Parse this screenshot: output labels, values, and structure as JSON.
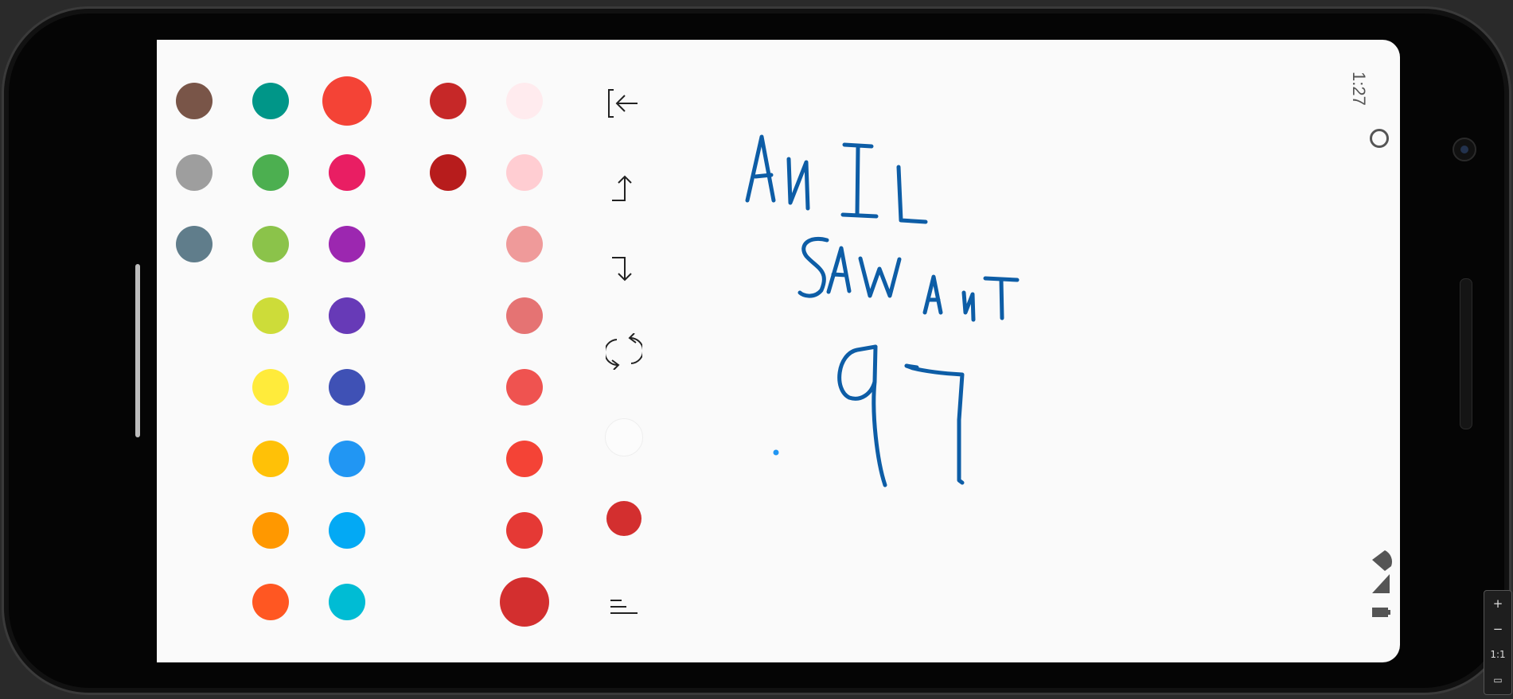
{
  "status_bar": {
    "time": "1:27"
  },
  "palette": {
    "col1": [
      "#795548",
      "#9e9e9e",
      "#607d8b"
    ],
    "col2": [
      "#009688",
      "#4caf50",
      "#8bc34a",
      "#cddc39",
      "#ffeb3b",
      "#ffc107",
      "#ff9800",
      "#ff5722"
    ],
    "col3": [
      "#f44336",
      "#e91e63",
      "#9c27b0",
      "#673ab7",
      "#3f51b5",
      "#2196f3",
      "#03a9f4",
      "#00bcd4"
    ],
    "col4": [
      "#c62828",
      "#b71c1c"
    ],
    "col5": [
      "#ffebee",
      "#ffcdd2",
      "#ef9a9a",
      "#e57373",
      "#ef5350",
      "#f44336",
      "#e53935",
      "#d32f2f"
    ]
  },
  "toolbar": {
    "exit_icon": "exit-icon",
    "undo_icon": "undo-icon",
    "redo_icon": "redo-icon",
    "sync_icon": "sync-icon",
    "current_color": "#d32f2f",
    "menu_icon": "menu-icon"
  },
  "canvas": {
    "stroke_color": "#0d5da6",
    "dot_color": "#2196f3"
  },
  "zoom_controls": {
    "plus": "+",
    "minus": "−",
    "reset": "1:1"
  }
}
